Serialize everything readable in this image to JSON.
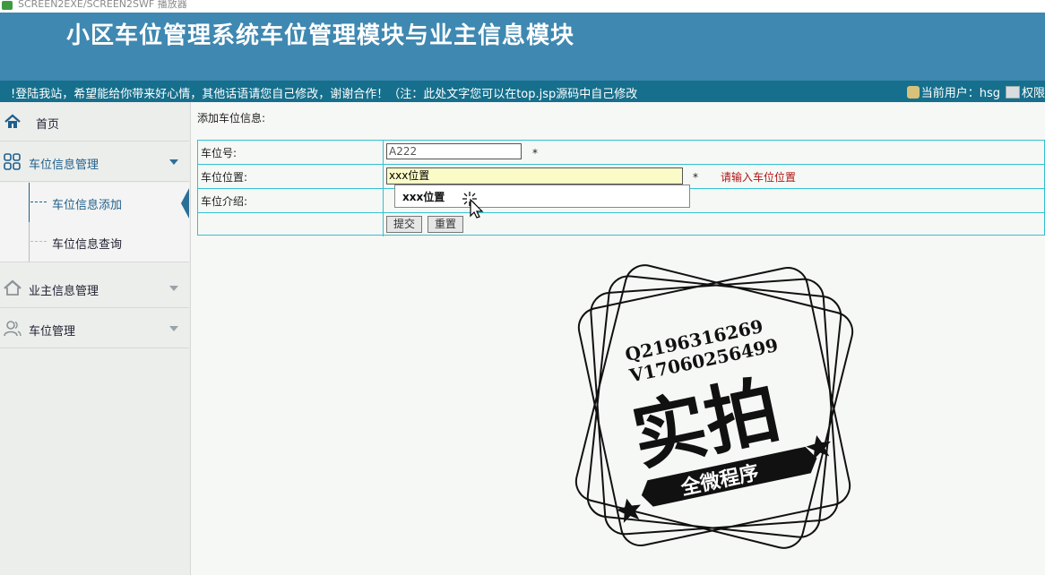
{
  "window": {
    "label": "SCREEN2EXE/SCREEN2SWF 播放器"
  },
  "header": {
    "title": "小区车位管理系统车位管理模块与业主信息模块",
    "notice": "!登陆我站，希望能给你带来好心情，其他话语请您自己修改，谢谢合作！（注：此处文字您可以在top.jsp源码中自己修改",
    "current_user_label": "当前用户：hsg",
    "perm_label": "权限"
  },
  "sidebar": {
    "home": "首页",
    "groups": [
      {
        "label": "车位信息管理",
        "expanded": true,
        "children": [
          "车位信息添加",
          "车位信息查询"
        ],
        "active_child": "车位信息添加"
      },
      {
        "label": "业主信息管理",
        "expanded": false
      },
      {
        "label": "车位管理",
        "expanded": false
      }
    ]
  },
  "content": {
    "page_label": "添加车位信息:",
    "form": {
      "rows": [
        {
          "label": "车位号:",
          "value": "A222",
          "required_mark": "*"
        },
        {
          "label": "车位位置:",
          "value": "xxx位置",
          "required_mark": "*",
          "error": "请输入车位位置"
        },
        {
          "label": "车位介绍:"
        }
      ],
      "submit_label": "提交",
      "reset_label": "重置"
    },
    "autocomplete_option": "xxx位置"
  },
  "watermark": {
    "line1": "Q2196316269",
    "line2": "V17060256499",
    "big": "实拍",
    "ribbon": "全微程序"
  },
  "colors": {
    "header_bg": "#3f88b1",
    "marquee_bg": "#166f8c",
    "sidebar_bg": "#eceeec",
    "table_border": "#33c0d3",
    "error_text": "#b01515"
  }
}
